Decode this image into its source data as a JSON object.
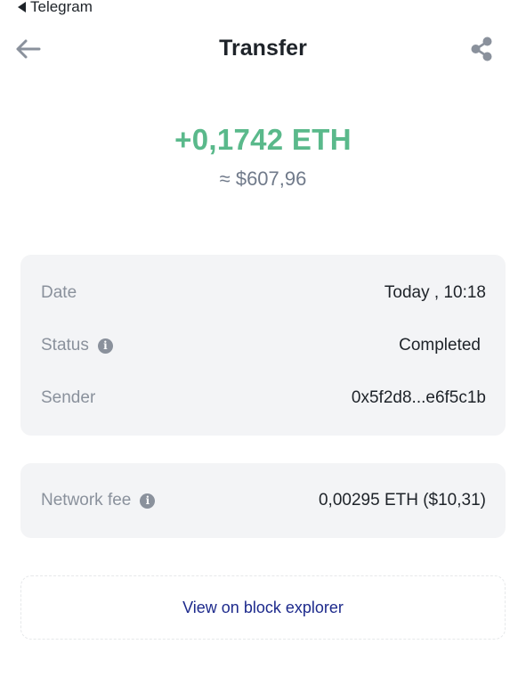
{
  "status_bar": {
    "back_app": "Telegram"
  },
  "header": {
    "title": "Transfer",
    "back_icon": "arrow-left-icon",
    "share_icon": "share-icon"
  },
  "summary": {
    "amount": "+0,1742 ETH",
    "fiat_approx": "≈  $607,96",
    "amount_color": "#5ab98b"
  },
  "details": {
    "date_label": "Date",
    "date_value": "Today , 10:18",
    "status_label": "Status",
    "status_value": "Completed",
    "sender_label": "Sender",
    "sender_value": "0x5f2d8...e6f5c1b"
  },
  "fee": {
    "label": "Network fee",
    "value": "0,00295 ETH ($10,31)"
  },
  "explorer": {
    "label": "View on block explorer",
    "color": "#1d2a8c"
  }
}
